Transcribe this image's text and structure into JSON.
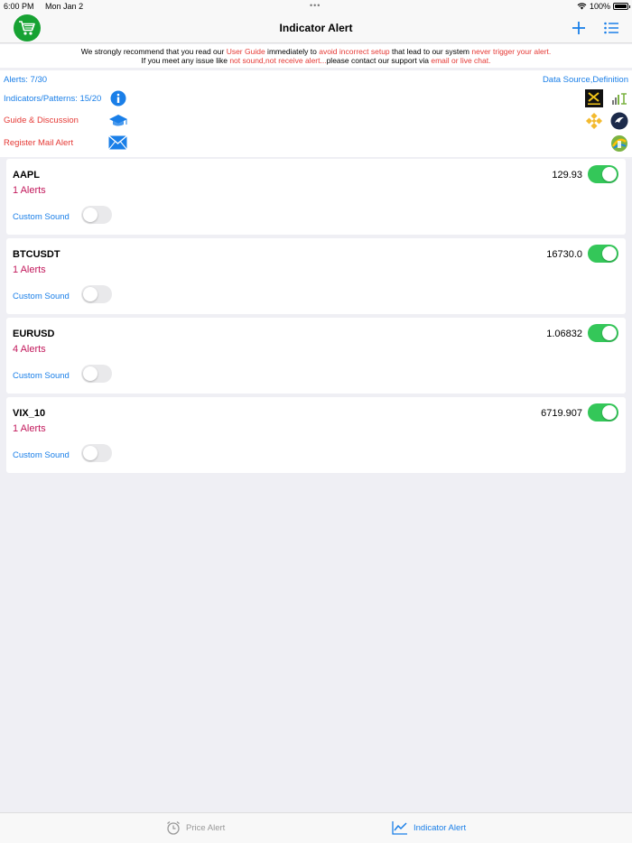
{
  "status_bar": {
    "time": "6:00 PM",
    "date": "Mon Jan 2",
    "battery": "100%"
  },
  "nav": {
    "title": "Indicator Alert"
  },
  "notice": {
    "l1_a": "We strongly recommend that you read our ",
    "l1_b": "User Guide",
    "l1_c": " immediately to ",
    "l1_d": "avoid incorrect setup",
    "l1_e": " that lead to our system ",
    "l1_f": "never trigger your alert.",
    "l2_a": "If you meet any issue like ",
    "l2_b": "not sound,not receive alert...",
    "l2_c": "please contact our support via ",
    "l2_d": "email or live chat."
  },
  "info": {
    "alerts": "Alerts: 7/30",
    "indicators": "Indicators/Patterns: 15/20",
    "guide": "Guide & Discussion",
    "register": "Register Mail Alert",
    "data_source": "Data Source,Definition"
  },
  "cards": [
    {
      "symbol": "AAPL",
      "price": "129.93",
      "alerts": "1 Alerts",
      "sound_label": "Custom Sound"
    },
    {
      "symbol": "BTCUSDT",
      "price": "16730.0",
      "alerts": "1 Alerts",
      "sound_label": "Custom Sound"
    },
    {
      "symbol": "EURUSD",
      "price": "1.06832",
      "alerts": "4 Alerts",
      "sound_label": "Custom Sound"
    },
    {
      "symbol": "VIX_10",
      "price": "6719.907",
      "alerts": "1 Alerts",
      "sound_label": "Custom Sound"
    }
  ],
  "tabs": {
    "price_alert": "Price Alert",
    "indicator_alert": "Indicator Alert"
  },
  "colors": {
    "accent": "#1a7fe8",
    "toggle_on": "#34c759",
    "alert_count": "#c2185b",
    "warning": "#e53935",
    "cart": "#17a233"
  }
}
